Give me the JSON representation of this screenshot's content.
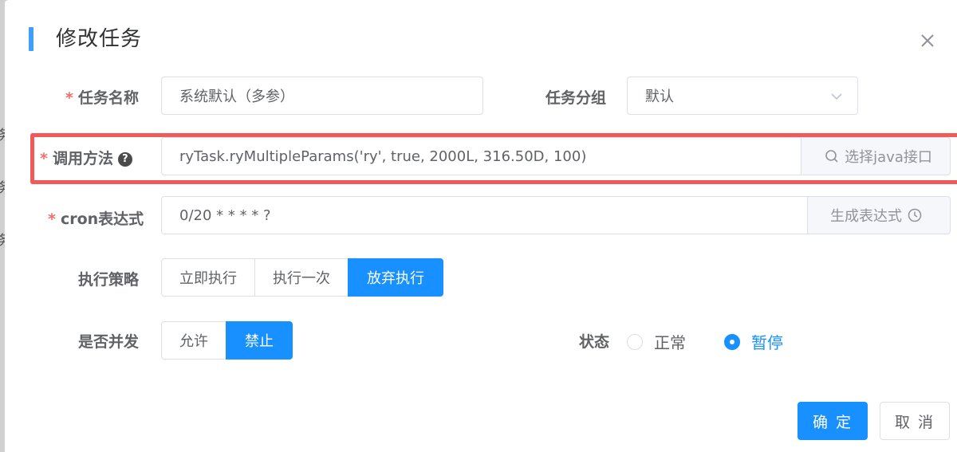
{
  "dialog": {
    "title": "修改任务",
    "close_label": "×"
  },
  "form": {
    "job_name": {
      "label": "任务名称",
      "value": "系统默认（多参）"
    },
    "job_group": {
      "label": "任务分组",
      "value": "默认"
    },
    "invoke_target": {
      "label": "调用方法",
      "value": "ryTask.ryMultipleParams('ry', true, 2000L, 316.50D, 100)",
      "append_label": "选择java接口"
    },
    "cron": {
      "label": "cron表达式",
      "value": "0/20 * * * * ?",
      "append_label": "生成表达式"
    },
    "misfire_policy": {
      "label": "执行策略",
      "options": [
        "立即执行",
        "执行一次",
        "放弃执行"
      ],
      "selected": "放弃执行"
    },
    "concurrent": {
      "label": "是否并发",
      "options": [
        "允许",
        "禁止"
      ],
      "selected": "禁止"
    },
    "status": {
      "label": "状态",
      "options": [
        "正常",
        "暂停"
      ],
      "selected": "暂停"
    }
  },
  "footer": {
    "confirm_label": "确 定",
    "cancel_label": "取 消"
  },
  "colors": {
    "primary": "#1890ff",
    "required": "#f56c6c",
    "highlight": "#f25a5a"
  }
}
